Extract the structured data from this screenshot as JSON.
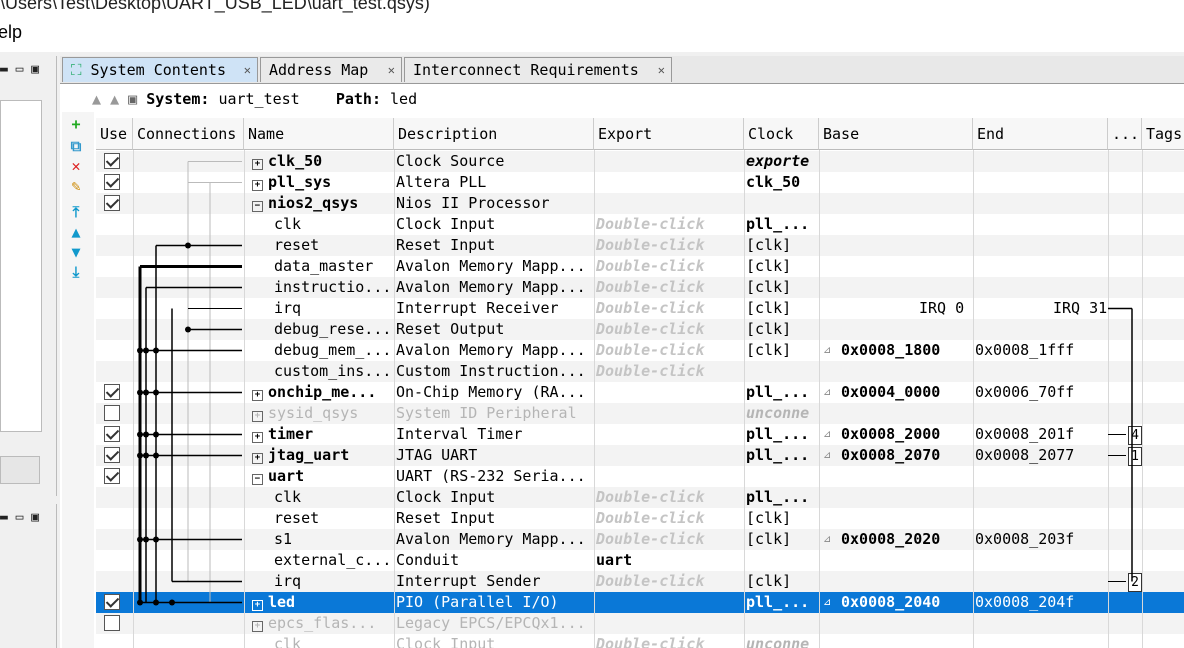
{
  "window": {
    "title": "\\Users\\Test\\Desktop\\UART_USB_LED\\uart_test.qsys)",
    "menu_help": "elp"
  },
  "tabs": [
    {
      "label": "System Contents",
      "active": true
    },
    {
      "label": "Address Map",
      "active": false
    },
    {
      "label": "Interconnect Requirements",
      "active": false
    }
  ],
  "system": {
    "system_label": "System:",
    "system_name": "uart_test",
    "path_label": "Path:",
    "path_value": "led"
  },
  "columns": [
    "Use",
    "Connections",
    "Name",
    "Description",
    "Export",
    "Clock",
    "Base",
    "End",
    "...",
    "Tags"
  ],
  "rows": [
    {
      "use": "on",
      "name": "clk_50",
      "desc": "Clock Source",
      "export": "",
      "clock": "exporte",
      "base": "",
      "end": "",
      "irq": "",
      "type": "top"
    },
    {
      "use": "on",
      "name": "pll_sys",
      "desc": "Altera PLL",
      "export": "",
      "clock": "clk_50",
      "base": "",
      "end": "",
      "irq": "",
      "type": "top"
    },
    {
      "use": "on",
      "name": "nios2_qsys",
      "desc": "Nios II Processor",
      "export": "",
      "clock": "",
      "base": "",
      "end": "",
      "irq": "",
      "type": "topopen"
    },
    {
      "use": "",
      "name": "clk",
      "desc": "Clock Input",
      "export": "Double-click",
      "clock": "pll_...",
      "base": "",
      "end": "",
      "irq": "",
      "type": "sub"
    },
    {
      "use": "",
      "name": "reset",
      "desc": "Reset Input",
      "export": "Double-click",
      "clock": "[clk]",
      "base": "",
      "end": "",
      "irq": "",
      "type": "sub"
    },
    {
      "use": "",
      "name": "data_master",
      "desc": "Avalon Memory Mapp...",
      "export": "Double-click",
      "clock": "[clk]",
      "base": "",
      "end": "",
      "irq": "",
      "type": "sub"
    },
    {
      "use": "",
      "name": "instructio...",
      "desc": "Avalon Memory Mapp...",
      "export": "Double-click",
      "clock": "[clk]",
      "base": "",
      "end": "",
      "irq": "",
      "type": "sub"
    },
    {
      "use": "",
      "name": "irq",
      "desc": "Interrupt Receiver",
      "export": "Double-click",
      "clock": "[clk]",
      "base": "IRQ 0",
      "end": "IRQ 31",
      "irq": "",
      "type": "sub"
    },
    {
      "use": "",
      "name": "debug_rese...",
      "desc": "Reset Output",
      "export": "Double-click",
      "clock": "[clk]",
      "base": "",
      "end": "",
      "irq": "",
      "type": "sub"
    },
    {
      "use": "",
      "name": "debug_mem_...",
      "desc": "Avalon Memory Mapp...",
      "export": "Double-click",
      "clock": "[clk]",
      "base": "0x0008_1800",
      "end": "0x0008_1fff",
      "irq": "",
      "type": "sub"
    },
    {
      "use": "",
      "name": "custom_ins...",
      "desc": "Custom Instruction...",
      "export": "Double-click",
      "clock": "",
      "base": "",
      "end": "",
      "irq": "",
      "type": "sub"
    },
    {
      "use": "on",
      "name": "onchip_me...",
      "desc": "On-Chip Memory (RA...",
      "export": "",
      "clock": "pll_...",
      "base": "0x0004_0000",
      "end": "0x0006_70ff",
      "irq": "",
      "type": "top"
    },
    {
      "use": "off",
      "name": "sysid_qsys",
      "desc": "System ID Peripheral",
      "export": "",
      "clock": "unconne",
      "base": "",
      "end": "",
      "irq": "",
      "type": "disabled"
    },
    {
      "use": "on",
      "name": "timer",
      "desc": "Interval Timer",
      "export": "",
      "clock": "pll_...",
      "base": "0x0008_2000",
      "end": "0x0008_201f",
      "irq": "4",
      "type": "top"
    },
    {
      "use": "on",
      "name": "jtag_uart",
      "desc": "JTAG UART",
      "export": "",
      "clock": "pll_...",
      "base": "0x0008_2070",
      "end": "0x0008_2077",
      "irq": "1",
      "type": "top"
    },
    {
      "use": "on",
      "name": "uart",
      "desc": "UART (RS-232 Seria...",
      "export": "",
      "clock": "",
      "base": "",
      "end": "",
      "irq": "",
      "type": "topopen"
    },
    {
      "use": "",
      "name": "clk",
      "desc": "Clock Input",
      "export": "Double-click",
      "clock": "pll_...",
      "base": "",
      "end": "",
      "irq": "",
      "type": "sub"
    },
    {
      "use": "",
      "name": "reset",
      "desc": "Reset Input",
      "export": "Double-click",
      "clock": "[clk]",
      "base": "",
      "end": "",
      "irq": "",
      "type": "sub"
    },
    {
      "use": "",
      "name": "s1",
      "desc": "Avalon Memory Mapp...",
      "export": "Double-click",
      "clock": "[clk]",
      "base": "0x0008_2020",
      "end": "0x0008_203f",
      "irq": "",
      "type": "sub"
    },
    {
      "use": "",
      "name": "external_c...",
      "desc": "Conduit",
      "export": "uart",
      "clock": "",
      "base": "",
      "end": "",
      "irq": "",
      "type": "sub"
    },
    {
      "use": "",
      "name": "irq",
      "desc": "Interrupt Sender",
      "export": "Double-click",
      "clock": "[clk]",
      "base": "",
      "end": "",
      "irq": "2",
      "type": "sub"
    },
    {
      "use": "on",
      "name": "led",
      "desc": "PIO (Parallel I/O)",
      "export": "",
      "clock": "pll_...",
      "base": "0x0008_2040",
      "end": "0x0008_204f",
      "irq": "",
      "type": "selected"
    },
    {
      "use": "off",
      "name": "epcs_flas...",
      "desc": "Legacy EPCS/EPCQx1...",
      "export": "",
      "clock": "",
      "base": "",
      "end": "",
      "irq": "",
      "type": "disabled"
    },
    {
      "use": "",
      "name": "clk",
      "desc": "Clock Input",
      "export": "Double-click",
      "clock": "unconne",
      "base": "",
      "end": "",
      "irq": "",
      "type": "subdisabled"
    }
  ]
}
